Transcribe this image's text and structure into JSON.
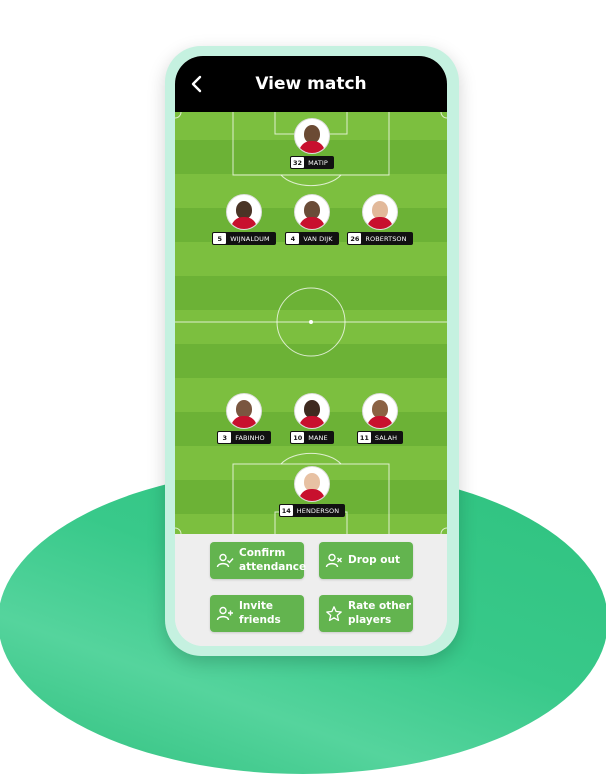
{
  "header": {
    "title": "View match"
  },
  "players": [
    {
      "number": "32",
      "name": "MATIP",
      "skin": "#6b4a34"
    },
    {
      "number": "5",
      "name": "WIJNALDUM",
      "skin": "#4a3426"
    },
    {
      "number": "4",
      "name": "VAN DIJK",
      "skin": "#6a4c38"
    },
    {
      "number": "26",
      "name": "ROBERTSON",
      "skin": "#e2b99a"
    },
    {
      "number": "3",
      "name": "FABINHO",
      "skin": "#7a5640"
    },
    {
      "number": "10",
      "name": "MANE",
      "skin": "#3e2a20"
    },
    {
      "number": "11",
      "name": "SALAH",
      "skin": "#8b6244"
    },
    {
      "number": "14",
      "name": "HENDERSON",
      "skin": "#e7c1a3"
    }
  ],
  "actions": {
    "confirm": "Confirm attendance",
    "drop_out": "Drop out",
    "invite": "Invite friends",
    "rate": "Rate other players"
  },
  "colors": {
    "pitch_light": "#7cbf3f",
    "pitch_dark": "#6cb236",
    "button": "#63b44f",
    "shirt": "#c8102e"
  }
}
